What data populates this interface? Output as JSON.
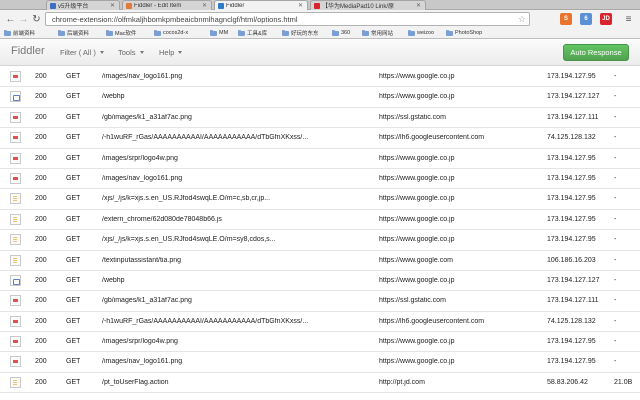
{
  "tabs": [
    {
      "label": "v5升级平台",
      "active": false,
      "favicon_color": "#3a6fc1"
    },
    {
      "label": "Fiddler - Edit Item",
      "active": false,
      "favicon_color": "#e07b39"
    },
    {
      "label": "Fiddler",
      "active": true,
      "favicon_color": "#2a7cc7"
    },
    {
      "label": "【华为MediaPad10 Link/原",
      "active": false,
      "favicon_color": "#d9232d"
    }
  ],
  "address_bar": {
    "url": "chrome-extension://olfmkaljhbomkpmbeaicbnmlhagnclgf/html/options.html"
  },
  "extensions": [
    "S",
    "6",
    "JD"
  ],
  "bookmarks": [
    "前端资料",
    "后端资料",
    "Mac软件",
    "cocos2d-x",
    "MM",
    "工具&库",
    "好玩的东东",
    "360",
    "常用网站",
    "weizoo",
    "PhotoShop"
  ],
  "app": {
    "brand": "Fiddler",
    "menu": {
      "filter": "Filter ( All )",
      "tools": "Tools",
      "help": "Help"
    },
    "auto_response": "Auto Response"
  },
  "requests": [
    {
      "type": "img",
      "status": "200",
      "method": "GET",
      "path": "/images/nav_logo161.png",
      "host": "https://www.google.co.jp",
      "ip": "173.194.127.95",
      "size": "-"
    },
    {
      "type": "html",
      "status": "200",
      "method": "GET",
      "path": "/webhp",
      "host": "https://www.google.co.jp",
      "ip": "173.194.127.127",
      "size": "-"
    },
    {
      "type": "img",
      "status": "200",
      "method": "GET",
      "path": "/gb/images/k1_a31af7ac.png",
      "host": "https://ssl.gstatic.com",
      "ip": "173.194.127.111",
      "size": "-"
    },
    {
      "type": "img",
      "status": "200",
      "method": "GET",
      "path": "/-h1wuRF_rGas/AAAAAAAAAAI/AAAAAAAAAAA/dTbGfnXKxss/...",
      "host": "https://lh6.googleusercontent.com",
      "ip": "74.125.128.132",
      "size": "-"
    },
    {
      "type": "img",
      "status": "200",
      "method": "GET",
      "path": "/images/srpr/logo4w.png",
      "host": "https://www.google.co.jp",
      "ip": "173.194.127.95",
      "size": "-"
    },
    {
      "type": "img",
      "status": "200",
      "method": "GET",
      "path": "/images/nav_logo161.png",
      "host": "https://www.google.co.jp",
      "ip": "173.194.127.95",
      "size": "-"
    },
    {
      "type": "js",
      "status": "200",
      "method": "GET",
      "path": "/xjs/_/js/k=xjs.s.en_US.RJfod4swqLE.O/m=c,sb,cr,jp...",
      "host": "https://www.google.co.jp",
      "ip": "173.194.127.95",
      "size": "-"
    },
    {
      "type": "js",
      "status": "200",
      "method": "GET",
      "path": "/extern_chrome/62d080de78048b66.js",
      "host": "https://www.google.co.jp",
      "ip": "173.194.127.95",
      "size": "-"
    },
    {
      "type": "js",
      "status": "200",
      "method": "GET",
      "path": "/xjs/_/js/k=xjs.s.en_US.RJfod4swqLE.O/m=sy8,cdos,s...",
      "host": "https://www.google.co.jp",
      "ip": "173.194.127.95",
      "size": "-"
    },
    {
      "type": "js",
      "status": "200",
      "method": "GET",
      "path": "/textinputassistant/tia.png",
      "host": "https://www.google.com",
      "ip": "106.186.16.203",
      "size": "-"
    },
    {
      "type": "html",
      "status": "200",
      "method": "GET",
      "path": "/webhp",
      "host": "https://www.google.co.jp",
      "ip": "173.194.127.127",
      "size": "-"
    },
    {
      "type": "img",
      "status": "200",
      "method": "GET",
      "path": "/gb/images/k1_a31af7ac.png",
      "host": "https://ssl.gstatic.com",
      "ip": "173.194.127.111",
      "size": "-"
    },
    {
      "type": "img",
      "status": "200",
      "method": "GET",
      "path": "/-h1wuRF_rGas/AAAAAAAAAAI/AAAAAAAAAAA/dTbGfnXKxss/...",
      "host": "https://lh6.googleusercontent.com",
      "ip": "74.125.128.132",
      "size": "-"
    },
    {
      "type": "img",
      "status": "200",
      "method": "GET",
      "path": "/images/srpr/logo4w.png",
      "host": "https://www.google.co.jp",
      "ip": "173.194.127.95",
      "size": "-"
    },
    {
      "type": "img",
      "status": "200",
      "method": "GET",
      "path": "/images/nav_logo161.png",
      "host": "https://www.google.co.jp",
      "ip": "173.194.127.95",
      "size": "-"
    },
    {
      "type": "js",
      "status": "200",
      "method": "GET",
      "path": "/pt_toUserFlag.action",
      "host": "http://pt.jd.com",
      "ip": "58.83.206.42",
      "size": "21.0B"
    }
  ]
}
